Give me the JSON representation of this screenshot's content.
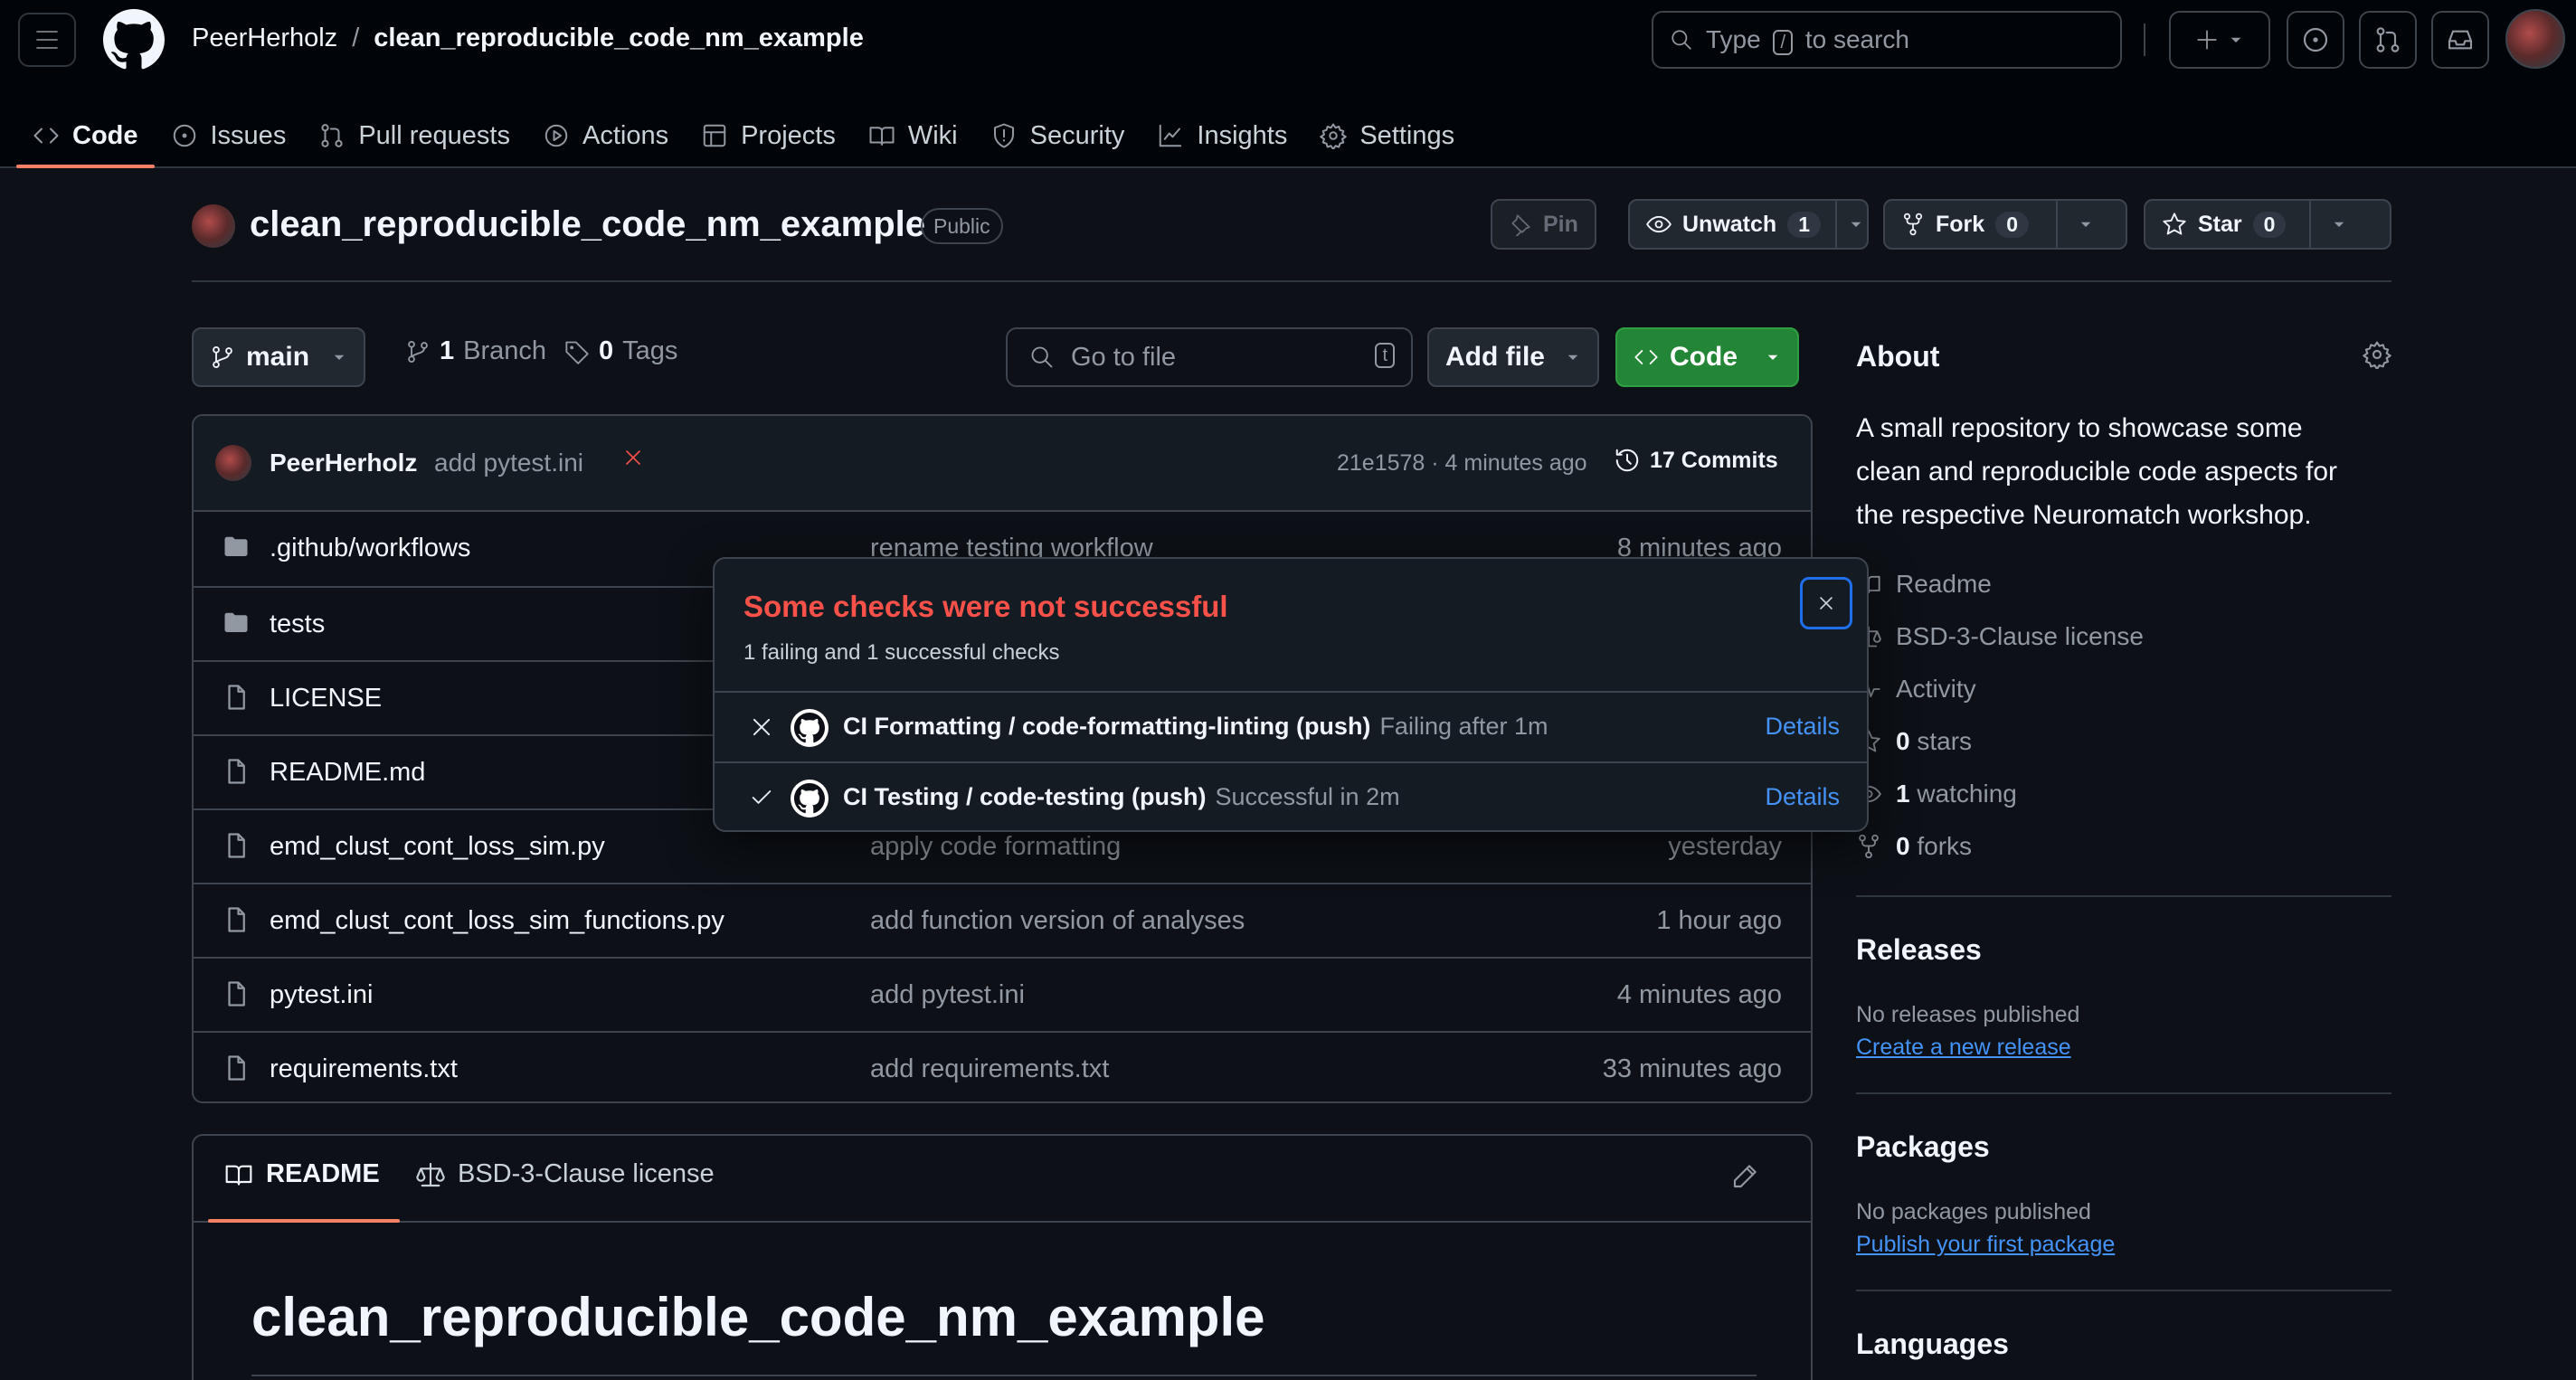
{
  "header": {
    "owner": "PeerHerholz",
    "separator": "/",
    "repo": "clean_reproducible_code_nm_example",
    "search": {
      "pre": "Type",
      "key": "/",
      "post": "to search"
    }
  },
  "nav": {
    "tabs": [
      {
        "label": "Code",
        "icon": "code-icon"
      },
      {
        "label": "Issues",
        "icon": "issue-icon"
      },
      {
        "label": "Pull requests",
        "icon": "pull-request-icon"
      },
      {
        "label": "Actions",
        "icon": "play-icon"
      },
      {
        "label": "Projects",
        "icon": "table-icon"
      },
      {
        "label": "Wiki",
        "icon": "book-icon"
      },
      {
        "label": "Security",
        "icon": "shield-icon"
      },
      {
        "label": "Insights",
        "icon": "graph-icon"
      },
      {
        "label": "Settings",
        "icon": "gear-icon"
      }
    ],
    "active": "Code"
  },
  "repo_header": {
    "title": "clean_reproducible_code_nm_example",
    "visibility": "Public",
    "pin_label": "Pin",
    "unwatch_label": "Unwatch",
    "unwatch_count": "1",
    "fork_label": "Fork",
    "fork_count": "0",
    "star_label": "Star",
    "star_count": "0"
  },
  "toolbar": {
    "branch": "main",
    "branch_count": "1",
    "branch_label": "Branch",
    "tag_count": "0",
    "tag_label": "Tags",
    "goto_placeholder": "Go to file",
    "goto_key": "t",
    "add_file": "Add file",
    "code": "Code"
  },
  "commit": {
    "user": "PeerHerholz",
    "message": "add pytest.ini",
    "status_icon": "x-icon",
    "sha_time": "21e1578 · 4 minutes ago",
    "commits_label": "17 Commits"
  },
  "files": [
    {
      "type": "folder",
      "name": ".github/workflows",
      "message": "rename testing workflow",
      "time": "8 minutes ago"
    },
    {
      "type": "folder",
      "name": "tests",
      "message": "",
      "time": ""
    },
    {
      "type": "file",
      "name": "LICENSE",
      "message": "",
      "time": ""
    },
    {
      "type": "file",
      "name": "README.md",
      "message": "",
      "time": ""
    },
    {
      "type": "file",
      "name": "emd_clust_cont_loss_sim.py",
      "message": "apply code formatting",
      "time": "yesterday"
    },
    {
      "type": "file",
      "name": "emd_clust_cont_loss_sim_functions.py",
      "message": "add function version of analyses",
      "time": "1 hour ago"
    },
    {
      "type": "file",
      "name": "pytest.ini",
      "message": "add pytest.ini",
      "time": "4 minutes ago"
    },
    {
      "type": "file",
      "name": "requirements.txt",
      "message": "add requirements.txt",
      "time": "33 minutes ago"
    }
  ],
  "readme": {
    "tab_readme": "README",
    "tab_license": "BSD-3-Clause license",
    "heading": "clean_reproducible_code_nm_example"
  },
  "about": {
    "title": "About",
    "description": "A small repository to showcase some clean and reproducible code aspects for the respective Neuromatch workshop.",
    "readme": "Readme",
    "license": "BSD-3-Clause license",
    "activity": "Activity",
    "stars_count": "0",
    "stars_label": "stars",
    "watching_count": "1",
    "watching_label": "watching",
    "forks_count": "0",
    "forks_label": "forks"
  },
  "releases": {
    "title": "Releases",
    "empty": "No releases published",
    "link": "Create a new release"
  },
  "packages": {
    "title": "Packages",
    "empty": "No packages published",
    "link": "Publish your first package"
  },
  "languages": {
    "title": "Languages"
  },
  "checks_popup": {
    "title": "Some checks were not successful",
    "subtitle": "1 failing and 1 successful checks",
    "checks": [
      {
        "status": "failing",
        "name": "CI Formatting / code-formatting-linting (push)",
        "detail": "Failing after 1m",
        "action": "Details"
      },
      {
        "status": "success",
        "name": "CI Testing / code-testing (push)",
        "detail": "Successful in 2m",
        "action": "Details"
      }
    ]
  },
  "colors": {
    "background": "#0d1117",
    "header": "#010409",
    "border": "#3d444d",
    "accent_tab": "#f78166",
    "link": "#4493f8",
    "danger": "#f85149",
    "success": "#3fb950",
    "green_button": "#238636"
  }
}
